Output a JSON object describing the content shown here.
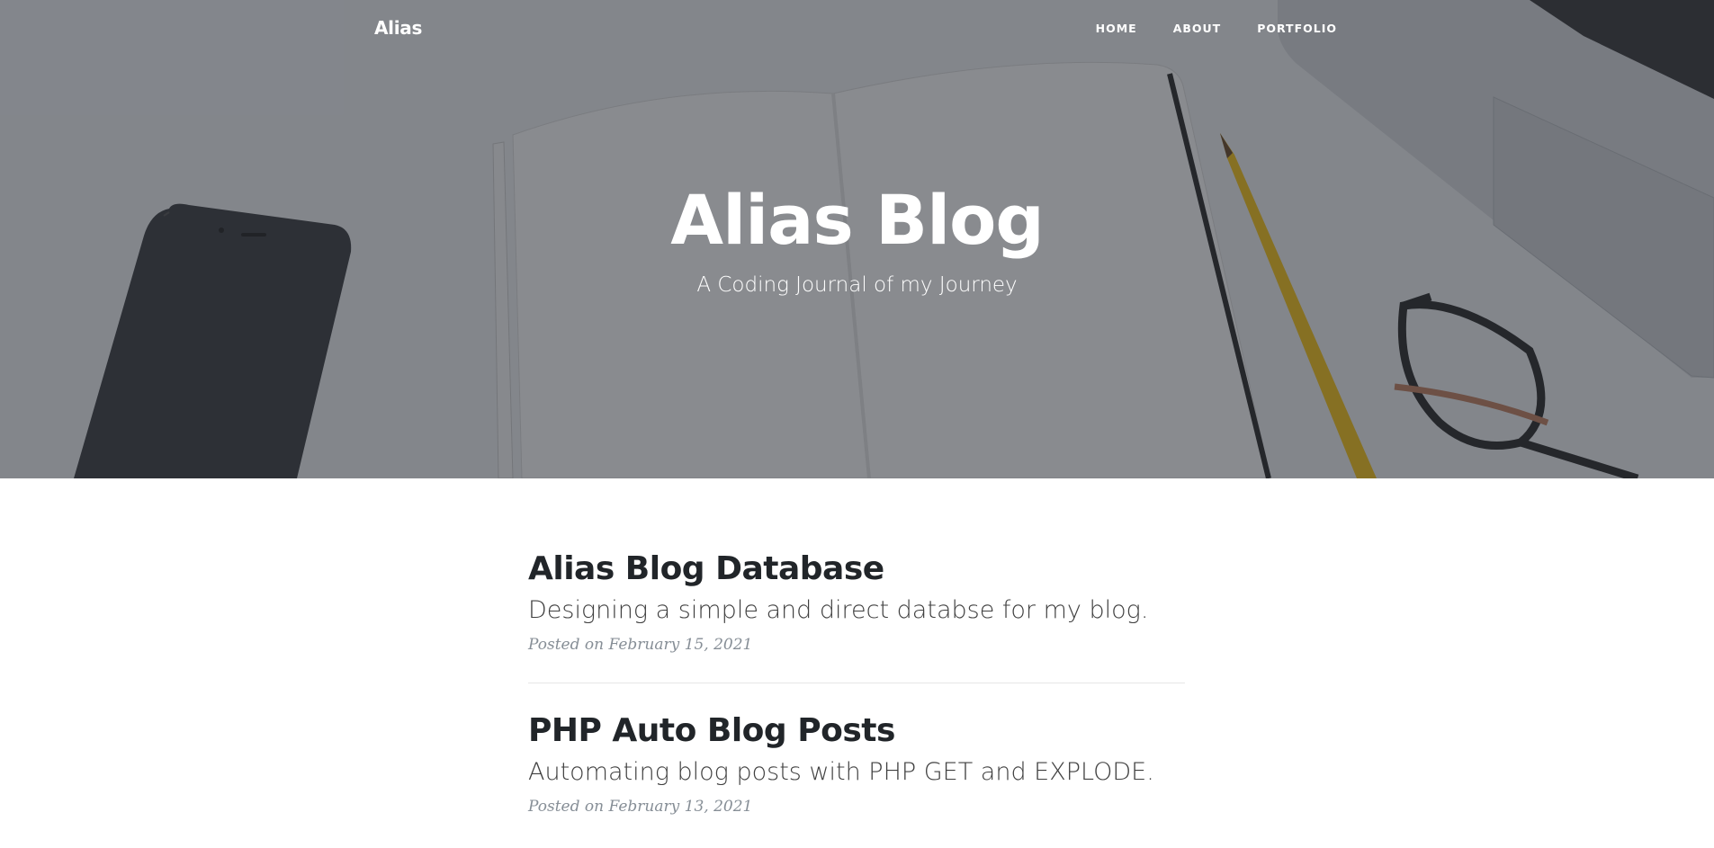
{
  "nav": {
    "brand": "Alias",
    "links": [
      "HOME",
      "ABOUT",
      "PORTFOLIO"
    ]
  },
  "hero": {
    "title": "Alias Blog",
    "subtitle": "A Coding Journal of my Journey"
  },
  "posts": [
    {
      "title": "Alias Blog Database",
      "subtitle": "Designing a simple and direct databse for my blog.",
      "meta": "Posted on February 15, 2021"
    },
    {
      "title": "PHP Auto Blog Posts",
      "subtitle": "Automating blog posts with PHP GET and EXPLODE.",
      "meta": "Posted on February 13, 2021"
    }
  ],
  "colors": {
    "text_dark": "#212529",
    "meta_gray": "#868e96",
    "overlay": "#21252d"
  },
  "icons": {
    "hero_background": "desk-photo-phone-notebook-pencil-glasses-laptop"
  }
}
